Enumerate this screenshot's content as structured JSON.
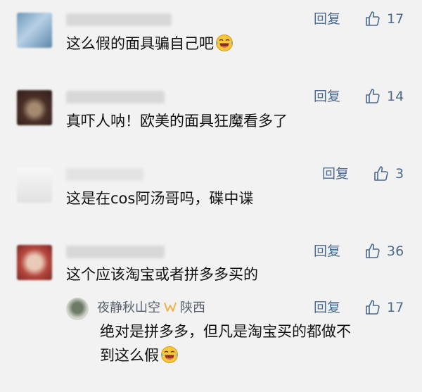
{
  "comments": [
    {
      "reply_label": "回复",
      "likes": "17",
      "text": "这么假的面具骗自己吧",
      "emoji": "laughing-tears-emoji",
      "avatar_colors": [
        "#7fa5c4",
        "#a9c8e0"
      ]
    },
    {
      "reply_label": "回复",
      "likes": "14",
      "text": "真吓人呐！欧美的面具狂魔看多了",
      "avatar_colors": [
        "#3a2a24",
        "#8b6a55"
      ]
    },
    {
      "reply_label": "回复",
      "likes": "3",
      "text": "这是在cos阿汤哥吗，碟中谍",
      "avatar_colors": [
        "#e6e6e6",
        "#f7f7f7"
      ]
    },
    {
      "reply_label": "回复",
      "likes": "36",
      "text": "这个应该淘宝或者拼多多买的",
      "avatar_colors": [
        "#b5473e",
        "#e7c8b8"
      ]
    }
  ],
  "reply": {
    "author": "夜静秋山空",
    "location": "陕西",
    "reply_label": "回复",
    "likes": "17",
    "text_line1": "绝对是拼多多，但凡是淘宝买的都做不",
    "text_line2": "到这么假",
    "emoji": "laughing-tears-emoji",
    "badge_icon": "ribbon-badge-icon"
  },
  "colors": {
    "background": "#f2f2f2",
    "link": "#4b6a8e",
    "badge": "#e8b64c",
    "text": "#111111",
    "muted": "#57606b"
  }
}
